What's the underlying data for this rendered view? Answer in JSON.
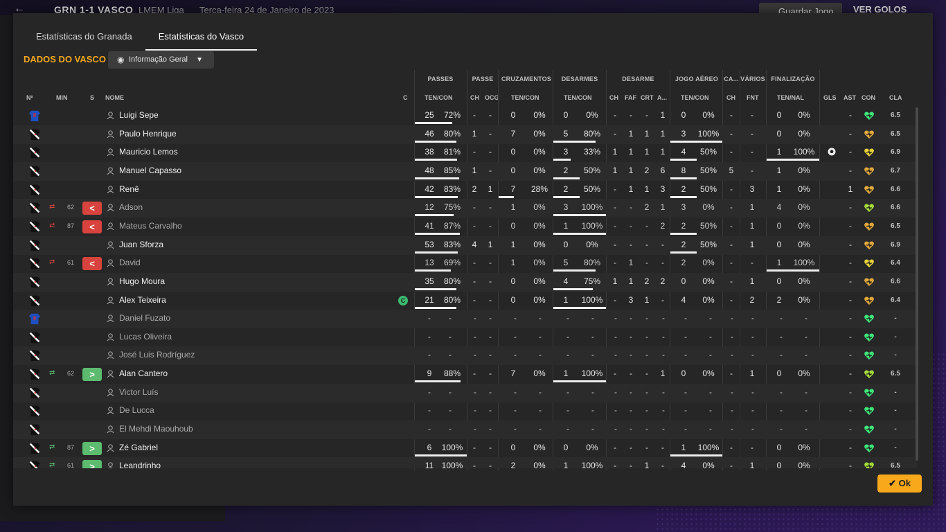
{
  "topbar": {
    "score": "GRN  1-1  VASCO",
    "league": "LMEM Liga",
    "date": "Terça-feira 24 de Janeiro de 2023",
    "save_label": "Guardar Jogo",
    "goals_label": "VER GOLOS"
  },
  "tabs": [
    {
      "label": "Estatísticas do Granada"
    },
    {
      "label": "Estatísticas do Vasco"
    }
  ],
  "section_title": "DADOS DO VASCO",
  "dropdown": {
    "label": "Informação Geral"
  },
  "group_headers": {
    "passes": "PASSES",
    "passe": "PASSE",
    "cruz": "CRUZAMENTOS",
    "desarmes": "DESARMES",
    "desarme": "DESARME",
    "aereo": "JOGO AÉREO",
    "ca": "CA...",
    "varios": "VÁRIOS",
    "final": "FINALIZAÇÃO"
  },
  "columns": {
    "no": "Nº",
    "min": "MIN",
    "s": "S",
    "nome": "NOME",
    "c": "C",
    "pas_tc": "TEN/CON",
    "ps_ch": "CH",
    "ps_ocg": "OCG",
    "cz_tc": "TEN/CON",
    "ds_tc": "TEN/CON",
    "de_ch": "CH",
    "de_faf": "FAF",
    "de_crt": "CRT",
    "de_a": "A...",
    "ja_tc": "TEN/CON",
    "ca_ch": "CH",
    "va_fnt": "FNT",
    "fi_tn": "TEN/NAL",
    "gls": "GLS",
    "ast": "AST",
    "con": "CON",
    "cla": "CLA"
  },
  "colors": {
    "accent": "#f7a81b",
    "sub_out": "#d8433d",
    "sub_in": "#5cbb6f",
    "heart_green": "#3ee67a",
    "heart_gold": "#e0a83a",
    "heart_yellow": "#e6d23a",
    "heart_lime": "#a6dc3a"
  },
  "players": [
    {
      "name": "Luigi Sepe",
      "gk": true,
      "min": "",
      "sub": "",
      "cap": false,
      "pas": [
        "25",
        "72%"
      ],
      "pas_r": 0.72,
      "ps": [
        "-",
        "-"
      ],
      "cz": [
        "0",
        "0%"
      ],
      "cz_r": 0,
      "ds": [
        "0",
        "0%"
      ],
      "ds_r": 0,
      "de": [
        "-",
        "-",
        "-",
        "1"
      ],
      "ja": [
        "0",
        "0%"
      ],
      "ja_r": 0,
      "ca": "-",
      "fnt": "-",
      "fi": [
        "0",
        "0%"
      ],
      "fi_r": 0,
      "gls": "",
      "ast": "-",
      "con": "green",
      "cla": "6.5"
    },
    {
      "name": "Paulo Henrique",
      "gk": false,
      "min": "",
      "sub": "",
      "cap": false,
      "pas": [
        "46",
        "80%"
      ],
      "pas_r": 0.8,
      "ps": [
        "1",
        "-"
      ],
      "cz": [
        "7",
        "0%"
      ],
      "cz_r": 0,
      "ds": [
        "5",
        "80%"
      ],
      "ds_r": 0.8,
      "de": [
        "-",
        "1",
        "1",
        "1"
      ],
      "ja": [
        "3",
        "100%"
      ],
      "ja_r": 1,
      "ca": "-",
      "fnt": "-",
      "fi": [
        "0",
        "0%"
      ],
      "fi_r": 0,
      "gls": "",
      "ast": "-",
      "con": "gold",
      "cla": "6.5"
    },
    {
      "name": "Mauricio Lemos",
      "gk": false,
      "min": "",
      "sub": "",
      "cap": false,
      "pas": [
        "38",
        "81%"
      ],
      "pas_r": 0.81,
      "ps": [
        "-",
        "-"
      ],
      "cz": [
        "0",
        "0%"
      ],
      "cz_r": 0,
      "ds": [
        "3",
        "33%"
      ],
      "ds_r": 0.33,
      "de": [
        "1",
        "1",
        "1",
        "1"
      ],
      "ja": [
        "4",
        "50%"
      ],
      "ja_r": 0.5,
      "ca": "-",
      "fnt": "-",
      "fi": [
        "1",
        "100%"
      ],
      "fi_r": 1,
      "gls": "goal",
      "ast": "-",
      "con": "yellow",
      "cla": "6.9"
    },
    {
      "name": "Manuel Capasso",
      "gk": false,
      "min": "",
      "sub": "",
      "cap": false,
      "pas": [
        "48",
        "85%"
      ],
      "pas_r": 0.85,
      "ps": [
        "1",
        "-"
      ],
      "cz": [
        "0",
        "0%"
      ],
      "cz_r": 0,
      "ds": [
        "2",
        "50%"
      ],
      "ds_r": 0.5,
      "de": [
        "1",
        "1",
        "2",
        "6"
      ],
      "ja": [
        "8",
        "50%"
      ],
      "ja_r": 0.5,
      "ca": "5",
      "fnt": "-",
      "fi": [
        "1",
        "0%"
      ],
      "fi_r": 0,
      "gls": "",
      "ast": "-",
      "con": "gold",
      "cla": "6.7"
    },
    {
      "name": "Renê",
      "gk": false,
      "min": "",
      "sub": "",
      "cap": false,
      "pas": [
        "42",
        "83%"
      ],
      "pas_r": 0.83,
      "ps": [
        "2",
        "1"
      ],
      "cz": [
        "7",
        "28%"
      ],
      "cz_r": 0.28,
      "ds": [
        "2",
        "50%"
      ],
      "ds_r": 0.5,
      "de": [
        "-",
        "1",
        "1",
        "3"
      ],
      "ja": [
        "2",
        "50%"
      ],
      "ja_r": 0.5,
      "ca": "-",
      "fnt": "3",
      "fi": [
        "1",
        "0%"
      ],
      "fi_r": 0,
      "gls": "",
      "ast": "1",
      "con": "gold",
      "cla": "6.6"
    },
    {
      "name": "Adson",
      "gk": false,
      "min": "62",
      "sub": "out",
      "cap": false,
      "pas": [
        "12",
        "75%"
      ],
      "pas_r": 0.75,
      "ps": [
        "-",
        "-"
      ],
      "cz": [
        "1",
        "0%"
      ],
      "cz_r": 0,
      "ds": [
        "3",
        "100%"
      ],
      "ds_r": 1,
      "de": [
        "-",
        "-",
        "2",
        "1"
      ],
      "ja": [
        "3",
        "0%"
      ],
      "ja_r": 0,
      "ca": "-",
      "fnt": "1",
      "fi": [
        "4",
        "0%"
      ],
      "fi_r": 0,
      "gls": "",
      "ast": "-",
      "con": "lime",
      "cla": "6.6"
    },
    {
      "name": "Mateus Carvalho",
      "gk": false,
      "min": "87",
      "sub": "out",
      "cap": false,
      "pas": [
        "41",
        "87%"
      ],
      "pas_r": 0.87,
      "ps": [
        "-",
        "-"
      ],
      "cz": [
        "0",
        "0%"
      ],
      "cz_r": 0,
      "ds": [
        "1",
        "100%"
      ],
      "ds_r": 1,
      "de": [
        "-",
        "-",
        "-",
        "2"
      ],
      "ja": [
        "2",
        "50%"
      ],
      "ja_r": 0.5,
      "ca": "-",
      "fnt": "1",
      "fi": [
        "0",
        "0%"
      ],
      "fi_r": 0,
      "gls": "",
      "ast": "-",
      "con": "gold",
      "cla": "6.5"
    },
    {
      "name": "Juan Sforza",
      "gk": false,
      "min": "",
      "sub": "",
      "cap": false,
      "pas": [
        "53",
        "83%"
      ],
      "pas_r": 0.83,
      "ps": [
        "4",
        "1"
      ],
      "cz": [
        "1",
        "0%"
      ],
      "cz_r": 0,
      "ds": [
        "0",
        "0%"
      ],
      "ds_r": 0,
      "de": [
        "-",
        "-",
        "-",
        "-"
      ],
      "ja": [
        "2",
        "50%"
      ],
      "ja_r": 0.5,
      "ca": "-",
      "fnt": "1",
      "fi": [
        "0",
        "0%"
      ],
      "fi_r": 0,
      "gls": "",
      "ast": "-",
      "con": "gold",
      "cla": "6.9"
    },
    {
      "name": "David",
      "gk": false,
      "min": "61",
      "sub": "out",
      "cap": false,
      "pas": [
        "13",
        "69%"
      ],
      "pas_r": 0.69,
      "ps": [
        "-",
        "-"
      ],
      "cz": [
        "1",
        "0%"
      ],
      "cz_r": 0,
      "ds": [
        "5",
        "80%"
      ],
      "ds_r": 0.8,
      "de": [
        "-",
        "1",
        "-",
        "-"
      ],
      "ja": [
        "2",
        "0%"
      ],
      "ja_r": 0,
      "ca": "-",
      "fnt": "-",
      "fi": [
        "1",
        "100%"
      ],
      "fi_r": 1,
      "gls": "",
      "ast": "-",
      "con": "yellow",
      "cla": "6.4"
    },
    {
      "name": "Hugo Moura",
      "gk": false,
      "min": "",
      "sub": "",
      "cap": false,
      "pas": [
        "35",
        "80%"
      ],
      "pas_r": 0.8,
      "ps": [
        "-",
        "-"
      ],
      "cz": [
        "0",
        "0%"
      ],
      "cz_r": 0,
      "ds": [
        "4",
        "75%"
      ],
      "ds_r": 0.75,
      "de": [
        "1",
        "1",
        "2",
        "2"
      ],
      "ja": [
        "0",
        "0%"
      ],
      "ja_r": 0,
      "ca": "-",
      "fnt": "1",
      "fi": [
        "0",
        "0%"
      ],
      "fi_r": 0,
      "gls": "",
      "ast": "-",
      "con": "gold",
      "cla": "6.6"
    },
    {
      "name": "Alex Teixeira",
      "gk": false,
      "min": "",
      "sub": "",
      "cap": true,
      "pas": [
        "21",
        "80%"
      ],
      "pas_r": 0.8,
      "ps": [
        "-",
        "-"
      ],
      "cz": [
        "0",
        "0%"
      ],
      "cz_r": 0,
      "ds": [
        "1",
        "100%"
      ],
      "ds_r": 1,
      "de": [
        "-",
        "3",
        "1",
        "-"
      ],
      "ja": [
        "4",
        "0%"
      ],
      "ja_r": 0,
      "ca": "-",
      "fnt": "2",
      "fi": [
        "2",
        "0%"
      ],
      "fi_r": 0,
      "gls": "",
      "ast": "-",
      "con": "gold",
      "cla": "6.4"
    },
    {
      "name": "Daniel Fuzato",
      "gk": true,
      "min": "",
      "sub": "",
      "cap": false,
      "bench": true,
      "con": "green",
      "cla": "-"
    },
    {
      "name": "Lucas Oliveira",
      "gk": false,
      "min": "",
      "sub": "",
      "cap": false,
      "bench": true,
      "con": "green",
      "cla": "-"
    },
    {
      "name": "José Luis Rodríguez",
      "gk": false,
      "min": "",
      "sub": "",
      "cap": false,
      "bench": true,
      "con": "green",
      "cla": "-"
    },
    {
      "name": "Alan Cantero",
      "gk": false,
      "min": "62",
      "sub": "in",
      "cap": false,
      "pas": [
        "9",
        "88%"
      ],
      "pas_r": 0.88,
      "ps": [
        "-",
        "-"
      ],
      "cz": [
        "7",
        "0%"
      ],
      "cz_r": 0,
      "ds": [
        "1",
        "100%"
      ],
      "ds_r": 1,
      "de": [
        "-",
        "-",
        "-",
        "1"
      ],
      "ja": [
        "0",
        "0%"
      ],
      "ja_r": 0,
      "ca": "-",
      "fnt": "1",
      "fi": [
        "0",
        "0%"
      ],
      "fi_r": 0,
      "gls": "",
      "ast": "-",
      "con": "lime",
      "cla": "6.5"
    },
    {
      "name": "Victor Luís",
      "gk": false,
      "min": "",
      "sub": "",
      "cap": false,
      "bench": true,
      "con": "green",
      "cla": "-"
    },
    {
      "name": "De Lucca",
      "gk": false,
      "min": "",
      "sub": "",
      "cap": false,
      "bench": true,
      "con": "green",
      "cla": "-"
    },
    {
      "name": "El Mehdi Maouhoub",
      "gk": false,
      "min": "",
      "sub": "",
      "cap": false,
      "bench": true,
      "con": "green",
      "cla": "-"
    },
    {
      "name": "Zé Gabriel",
      "gk": false,
      "min": "87",
      "sub": "in",
      "cap": false,
      "pas": [
        "6",
        "100%"
      ],
      "pas_r": 1,
      "ps": [
        "-",
        "-"
      ],
      "cz": [
        "0",
        "0%"
      ],
      "cz_r": 0,
      "ds": [
        "0",
        "0%"
      ],
      "ds_r": 0,
      "de": [
        "-",
        "-",
        "-",
        "-"
      ],
      "ja": [
        "1",
        "100%"
      ],
      "ja_r": 1,
      "ca": "-",
      "fnt": "-",
      "fi": [
        "0",
        "0%"
      ],
      "fi_r": 0,
      "gls": "",
      "ast": "-",
      "con": "green",
      "cla": "-"
    },
    {
      "name": "Leandrinho",
      "gk": false,
      "min": "61",
      "sub": "in",
      "cap": false,
      "pas": [
        "11",
        "100%"
      ],
      "pas_r": 1,
      "ps": [
        "-",
        "-"
      ],
      "cz": [
        "2",
        "0%"
      ],
      "cz_r": 0,
      "ds": [
        "1",
        "100%"
      ],
      "ds_r": 1,
      "de": [
        "-",
        "-",
        "1",
        "-"
      ],
      "ja": [
        "4",
        "0%"
      ],
      "ja_r": 0,
      "ca": "-",
      "fnt": "1",
      "fi": [
        "0",
        "0%"
      ],
      "fi_r": 0,
      "gls": "",
      "ast": "-",
      "con": "lime",
      "cla": "6.5"
    }
  ],
  "captain_mark": "C",
  "ok_label": "Ok"
}
